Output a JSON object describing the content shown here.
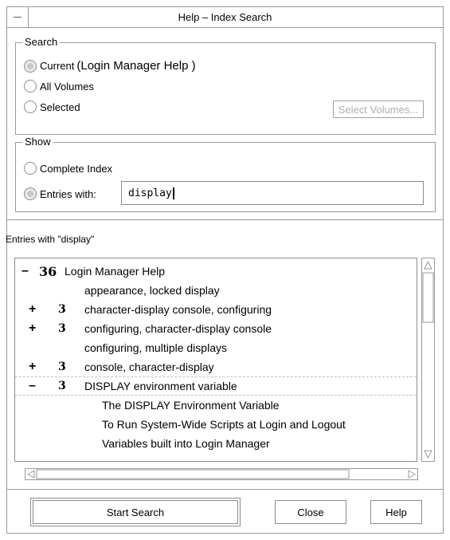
{
  "window": {
    "title": "Help – Index Search"
  },
  "search": {
    "legend": "Search",
    "options": [
      {
        "label": "Current",
        "detail": "(Login Manager Help )",
        "selected": true
      },
      {
        "label": "All Volumes",
        "selected": false
      },
      {
        "label": "Selected",
        "selected": false
      }
    ],
    "select_volumes_label": "Select Volumes..."
  },
  "show": {
    "legend": "Show",
    "options": [
      {
        "label": "Complete Index",
        "selected": false
      },
      {
        "label": "Entries with:",
        "selected": true
      }
    ],
    "entries_value": "display"
  },
  "results": {
    "header": "Entries with \"display\"",
    "rows": [
      {
        "expander": "–",
        "count": "36",
        "text": "Login Manager Help"
      },
      {
        "expander": "",
        "count": "",
        "text": "appearance, locked display"
      },
      {
        "expander": "+",
        "count": "3",
        "text": "character-display console, configuring"
      },
      {
        "expander": "+",
        "count": "3",
        "text": "configuring, character-display console"
      },
      {
        "expander": "",
        "count": "",
        "text": "configuring, multiple displays"
      },
      {
        "expander": "+",
        "count": "3",
        "text": "console, character-display"
      },
      {
        "expander": "–",
        "count": "3",
        "text": "DISPLAY environment variable"
      },
      {
        "expander": "",
        "count": "",
        "text": "The DISPLAY Environment Variable"
      },
      {
        "expander": "",
        "count": "",
        "text": "To Run System-Wide Scripts at Login and Logout"
      },
      {
        "expander": "",
        "count": "",
        "text": "Variables built into Login Manager"
      }
    ]
  },
  "buttons": {
    "start_search": "Start Search",
    "close": "Close",
    "help": "Help"
  }
}
